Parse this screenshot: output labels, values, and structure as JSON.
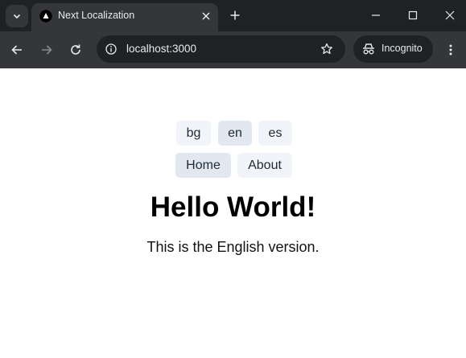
{
  "browser": {
    "tab": {
      "title": "Next Localization"
    },
    "address": {
      "url": "localhost:3000"
    },
    "profile": {
      "label": "Incognito"
    },
    "icons": {
      "tab_search": "chevron-down-icon",
      "favicon": "nextjs-triangle-icon",
      "close": "close-icon",
      "new_tab": "plus-icon",
      "minimize": "minimize-icon",
      "maximize": "maximize-icon",
      "window_close": "close-icon",
      "back": "arrow-left-icon",
      "forward": "arrow-right-icon",
      "reload": "reload-icon",
      "site_info": "info-icon",
      "bookmark": "star-icon",
      "incognito": "incognito-icon",
      "menu": "more-vertical-icon"
    },
    "colors": {
      "tabbar": "#202124",
      "toolbar": "#35363a",
      "text": "#e8eaed"
    }
  },
  "page": {
    "languages": [
      {
        "code": "bg",
        "active": false
      },
      {
        "code": "en",
        "active": true
      },
      {
        "code": "es",
        "active": false
      }
    ],
    "nav": [
      {
        "label": "Home",
        "active": true
      },
      {
        "label": "About",
        "active": false
      }
    ],
    "heading": "Hello World!",
    "message": "This is the English version.",
    "colors": {
      "pill": "#f1f4f9",
      "pill_active": "#e2e8f0"
    }
  }
}
